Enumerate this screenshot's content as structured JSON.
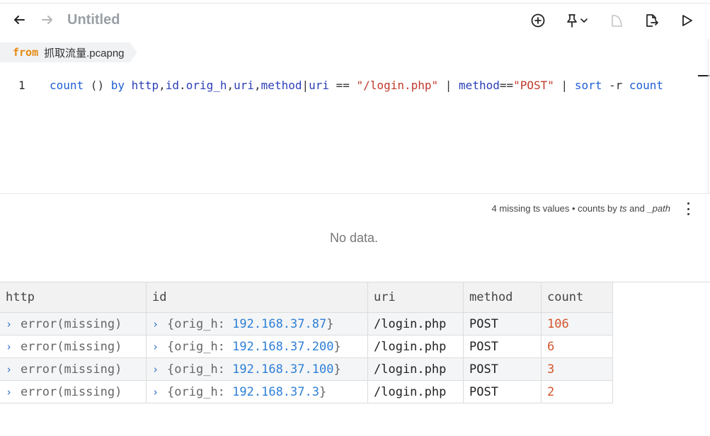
{
  "toolbar": {
    "title": "Untitled",
    "icons": [
      "back-arrow-icon",
      "forward-arrow-icon",
      "add-circle-icon",
      "pin-icon",
      "chevron-down-icon",
      "save-shape-icon",
      "export-icon",
      "run-icon"
    ]
  },
  "from_chip": {
    "keyword": "from",
    "file": "抓取流量.pcapng"
  },
  "editor": {
    "line_number": "1",
    "tokens": {
      "t1": "count",
      "t2": " () ",
      "t3": "by",
      "t4": " ",
      "t5": "http",
      "t6": ",",
      "t7": "id",
      "t8": ".",
      "t9": "orig_h",
      "t10": ",",
      "t11": "uri",
      "t12": ",",
      "t13": "method",
      "t14": "|",
      "t15": "uri",
      "t16": " == ",
      "t17": "\"/login.php\"",
      "t18": " | ",
      "t19": "method",
      "t20": "==",
      "t21": "\"POST\"",
      "t22": " | ",
      "t23": "sort",
      "t24": " -r ",
      "t25": "count"
    }
  },
  "chart": {
    "note_prefix": "4 missing ts values • counts by ",
    "note_ts": "ts",
    "note_and": " and ",
    "note_path": "_path",
    "empty_text": "No data."
  },
  "results": {
    "headers": [
      "http",
      "id",
      "uri",
      "method",
      "count"
    ],
    "rows": [
      {
        "http": "error(missing)",
        "id_prefix": "{orig_h: ",
        "ip": "192.168.37.87",
        "id_suffix": "}",
        "uri": "/login.php",
        "method": "POST",
        "count": "106"
      },
      {
        "http": "error(missing)",
        "id_prefix": "{orig_h: ",
        "ip": "192.168.37.200",
        "id_suffix": "}",
        "uri": "/login.php",
        "method": "POST",
        "count": "6"
      },
      {
        "http": "error(missing)",
        "id_prefix": "{orig_h: ",
        "ip": "192.168.37.100",
        "id_suffix": "}",
        "uri": "/login.php",
        "method": "POST",
        "count": "3"
      },
      {
        "http": "error(missing)",
        "id_prefix": "{orig_h: ",
        "ip": "192.168.37.3",
        "id_suffix": "}",
        "uri": "/login.php",
        "method": "POST",
        "count": "2"
      }
    ]
  },
  "colors": {
    "keyword_orange": "#e58a13",
    "code_blue": "#1f5fd6",
    "string_red": "#c0392b",
    "ip_blue": "#2d7fd6",
    "count_red": "#d3542c"
  }
}
